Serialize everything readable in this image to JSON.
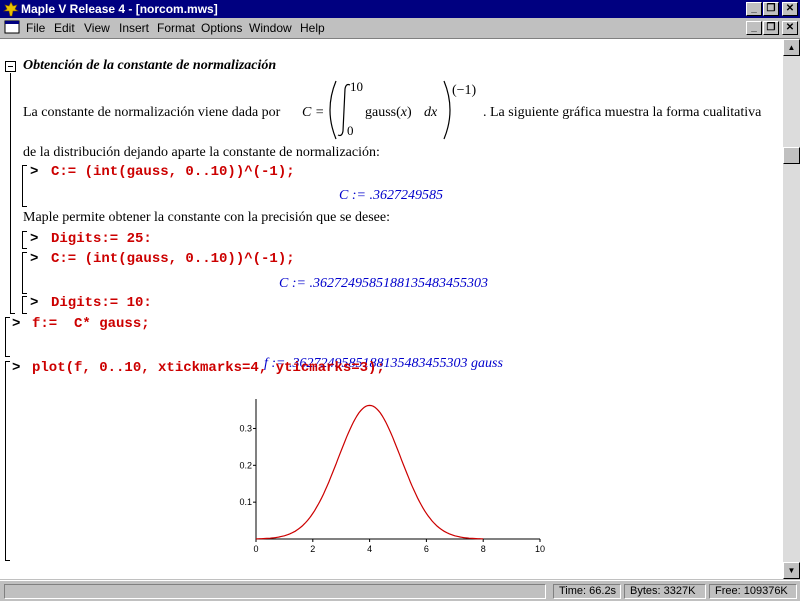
{
  "window": {
    "title": "Maple V Release 4 - [norcom.mws]"
  },
  "menu": [
    "File",
    "Edit",
    "View",
    "Insert",
    "Format",
    "Options",
    "Window",
    "Help"
  ],
  "section": {
    "title": "Obtención de la constante de normalización",
    "paragraph1_before": "La constante de normalización viene dada por",
    "formula": {
      "lhs": "C =",
      "upper": "10",
      "lower": "0",
      "integrand": "gauss(",
      "var": "x",
      "close": ")",
      "dx": "dx",
      "exponent": "(−1)"
    },
    "paragraph1_after": ". La siguiente gráfica muestra la forma cualitativa",
    "paragraph1_line2": "de la distribución dejando aparte la constante de normalización:",
    "input1": "C:= (int(gauss, 0..10))^(-1);",
    "output1": "C := .3627249585",
    "paragraph2": "Maple permite obtener la constante con la precisión que se desee:",
    "input2": "Digits:= 25:",
    "input3": "C:= (int(gauss, 0..10))^(-1);",
    "output3": "C := .3627249585188135483455303",
    "input4": "Digits:= 10:"
  },
  "main": {
    "input5": "f:=  C* gauss;",
    "output5_prefix": "f := .3627249585188135483455303",
    "output5_suffix": "gauss",
    "input6": "plot(f, 0..10, xtickmarks=4, yticmarks=3);",
    "prompt": ">"
  },
  "chart_data": {
    "type": "line",
    "title": "",
    "xlabel": "",
    "ylabel": "",
    "xlim": [
      0,
      10
    ],
    "ylim": [
      0,
      0.38
    ],
    "x_ticks": [
      "0",
      "2",
      "4",
      "6",
      "8",
      "10"
    ],
    "y_ticks": [
      "0.1",
      "0.2",
      "0.3"
    ],
    "series": [
      {
        "color": "#cc0000",
        "mean": 4,
        "sigma": 1.1,
        "peak": 0.3627,
        "x": [
          0,
          0.5,
          1,
          1.5,
          2,
          2.5,
          3,
          3.5,
          4,
          4.5,
          5,
          5.5,
          6,
          6.5,
          7,
          7.5,
          8
        ],
        "y": [
          0.0005,
          0.0021,
          0.0087,
          0.0276,
          0.0694,
          0.1337,
          0.2039,
          0.3277,
          0.3627,
          0.3277,
          0.2039,
          0.1337,
          0.0694,
          0.0276,
          0.0087,
          0.0021,
          0.0005
        ]
      }
    ]
  },
  "status": {
    "time": "Time:  66.2s",
    "bytes": "Bytes:  3327K",
    "free": "Free:  109376K"
  },
  "colors": {
    "titlebar": "#000080",
    "input": "#cc0000",
    "output": "#0000cc"
  }
}
